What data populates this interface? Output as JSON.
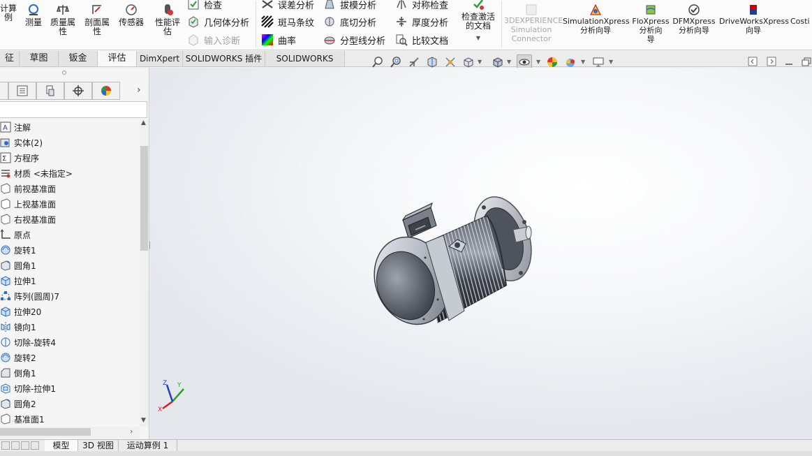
{
  "ribbon": {
    "big_buttons": [
      {
        "id": "calc",
        "label1": "计算",
        "label2": "例"
      },
      {
        "id": "measure",
        "label1": "测量",
        "label2": ""
      },
      {
        "id": "mass",
        "label1": "质量属",
        "label2": "性"
      },
      {
        "id": "section",
        "label1": "剖面属",
        "label2": "性"
      },
      {
        "id": "sensor",
        "label1": "传感器",
        "label2": ""
      },
      {
        "id": "perf",
        "label1": "性能评",
        "label2": "估"
      }
    ],
    "small_col1": [
      "检查",
      "几何体分析",
      "输入诊断"
    ],
    "small_col2": [
      "误差分析",
      "斑马条纹",
      "曲率"
    ],
    "small_col3": [
      "拔模分析",
      "底切分析",
      "分型线分析"
    ],
    "small_col4": [
      "对称检查",
      "厚度分析",
      "比较文档"
    ],
    "check_active": {
      "label1": "检查激活",
      "label2": "的文档"
    },
    "addins": [
      {
        "id": "3dx",
        "line1": "3DEXPERIENCE",
        "line2": "Simulation",
        "line3": "Connector"
      },
      {
        "id": "simx",
        "line1": "SimulationXpress",
        "line2": "分析向导",
        "line3": ""
      },
      {
        "id": "flox",
        "line1": "FloXpress",
        "line2": "分析向",
        "line3": "导"
      },
      {
        "id": "dfmx",
        "line1": "DFMXpress",
        "line2": "分析向导",
        "line3": ""
      },
      {
        "id": "dwx",
        "line1": "DriveWorksXpress",
        "line2": "向导",
        "line3": ""
      },
      {
        "id": "cost",
        "line1": "Costi",
        "line2": "",
        "line3": ""
      }
    ]
  },
  "tabs": [
    {
      "label": "征",
      "active": false
    },
    {
      "label": "草图",
      "active": false
    },
    {
      "label": "钣金",
      "active": false
    },
    {
      "label": "评估",
      "active": true
    },
    {
      "label": "DimXpert",
      "active": false
    },
    {
      "label": "SOLIDWORKS 插件",
      "active": false
    },
    {
      "label": "SOLIDWORKS MBD",
      "active": false
    }
  ],
  "tree": [
    {
      "label": "注解",
      "icon": "annotation-icon"
    },
    {
      "label": "实体(2)",
      "icon": "solid-bodies-icon"
    },
    {
      "label": "方程序",
      "icon": "equations-icon"
    },
    {
      "label": "材质 <未指定>",
      "icon": "material-icon"
    },
    {
      "label": "前视基准面",
      "icon": "plane-icon"
    },
    {
      "label": "上视基准面",
      "icon": "plane-icon"
    },
    {
      "label": "右视基准面",
      "icon": "plane-icon"
    },
    {
      "label": "原点",
      "icon": "origin-icon"
    },
    {
      "label": "旋转1",
      "icon": "revolve-icon"
    },
    {
      "label": "圆角1",
      "icon": "fillet-icon"
    },
    {
      "label": "拉伸1",
      "icon": "extrude-icon"
    },
    {
      "label": "阵列(圆周)7",
      "icon": "circular-pattern-icon"
    },
    {
      "label": "拉伸20",
      "icon": "extrude-icon"
    },
    {
      "label": "镜向1",
      "icon": "mirror-icon"
    },
    {
      "label": "切除-旋转4",
      "icon": "cut-revolve-icon"
    },
    {
      "label": "旋转2",
      "icon": "revolve-icon"
    },
    {
      "label": "倒角1",
      "icon": "chamfer-icon"
    },
    {
      "label": "切除-拉伸1",
      "icon": "cut-extrude-icon"
    },
    {
      "label": "圆角2",
      "icon": "fillet-icon"
    },
    {
      "label": "基准面1",
      "icon": "plane-icon"
    }
  ],
  "bottom_tabs": [
    {
      "label": "模型",
      "active": true
    },
    {
      "label": "3D 视图",
      "active": false
    },
    {
      "label": "运动算例 1",
      "active": false
    }
  ],
  "triad": {
    "x": "X",
    "y": "Y",
    "z": "Z"
  },
  "colors": {
    "accent": "#1f5fbf",
    "ribbon_bg": "#fbfbfb",
    "viewport_bg": "#eef0f3"
  }
}
